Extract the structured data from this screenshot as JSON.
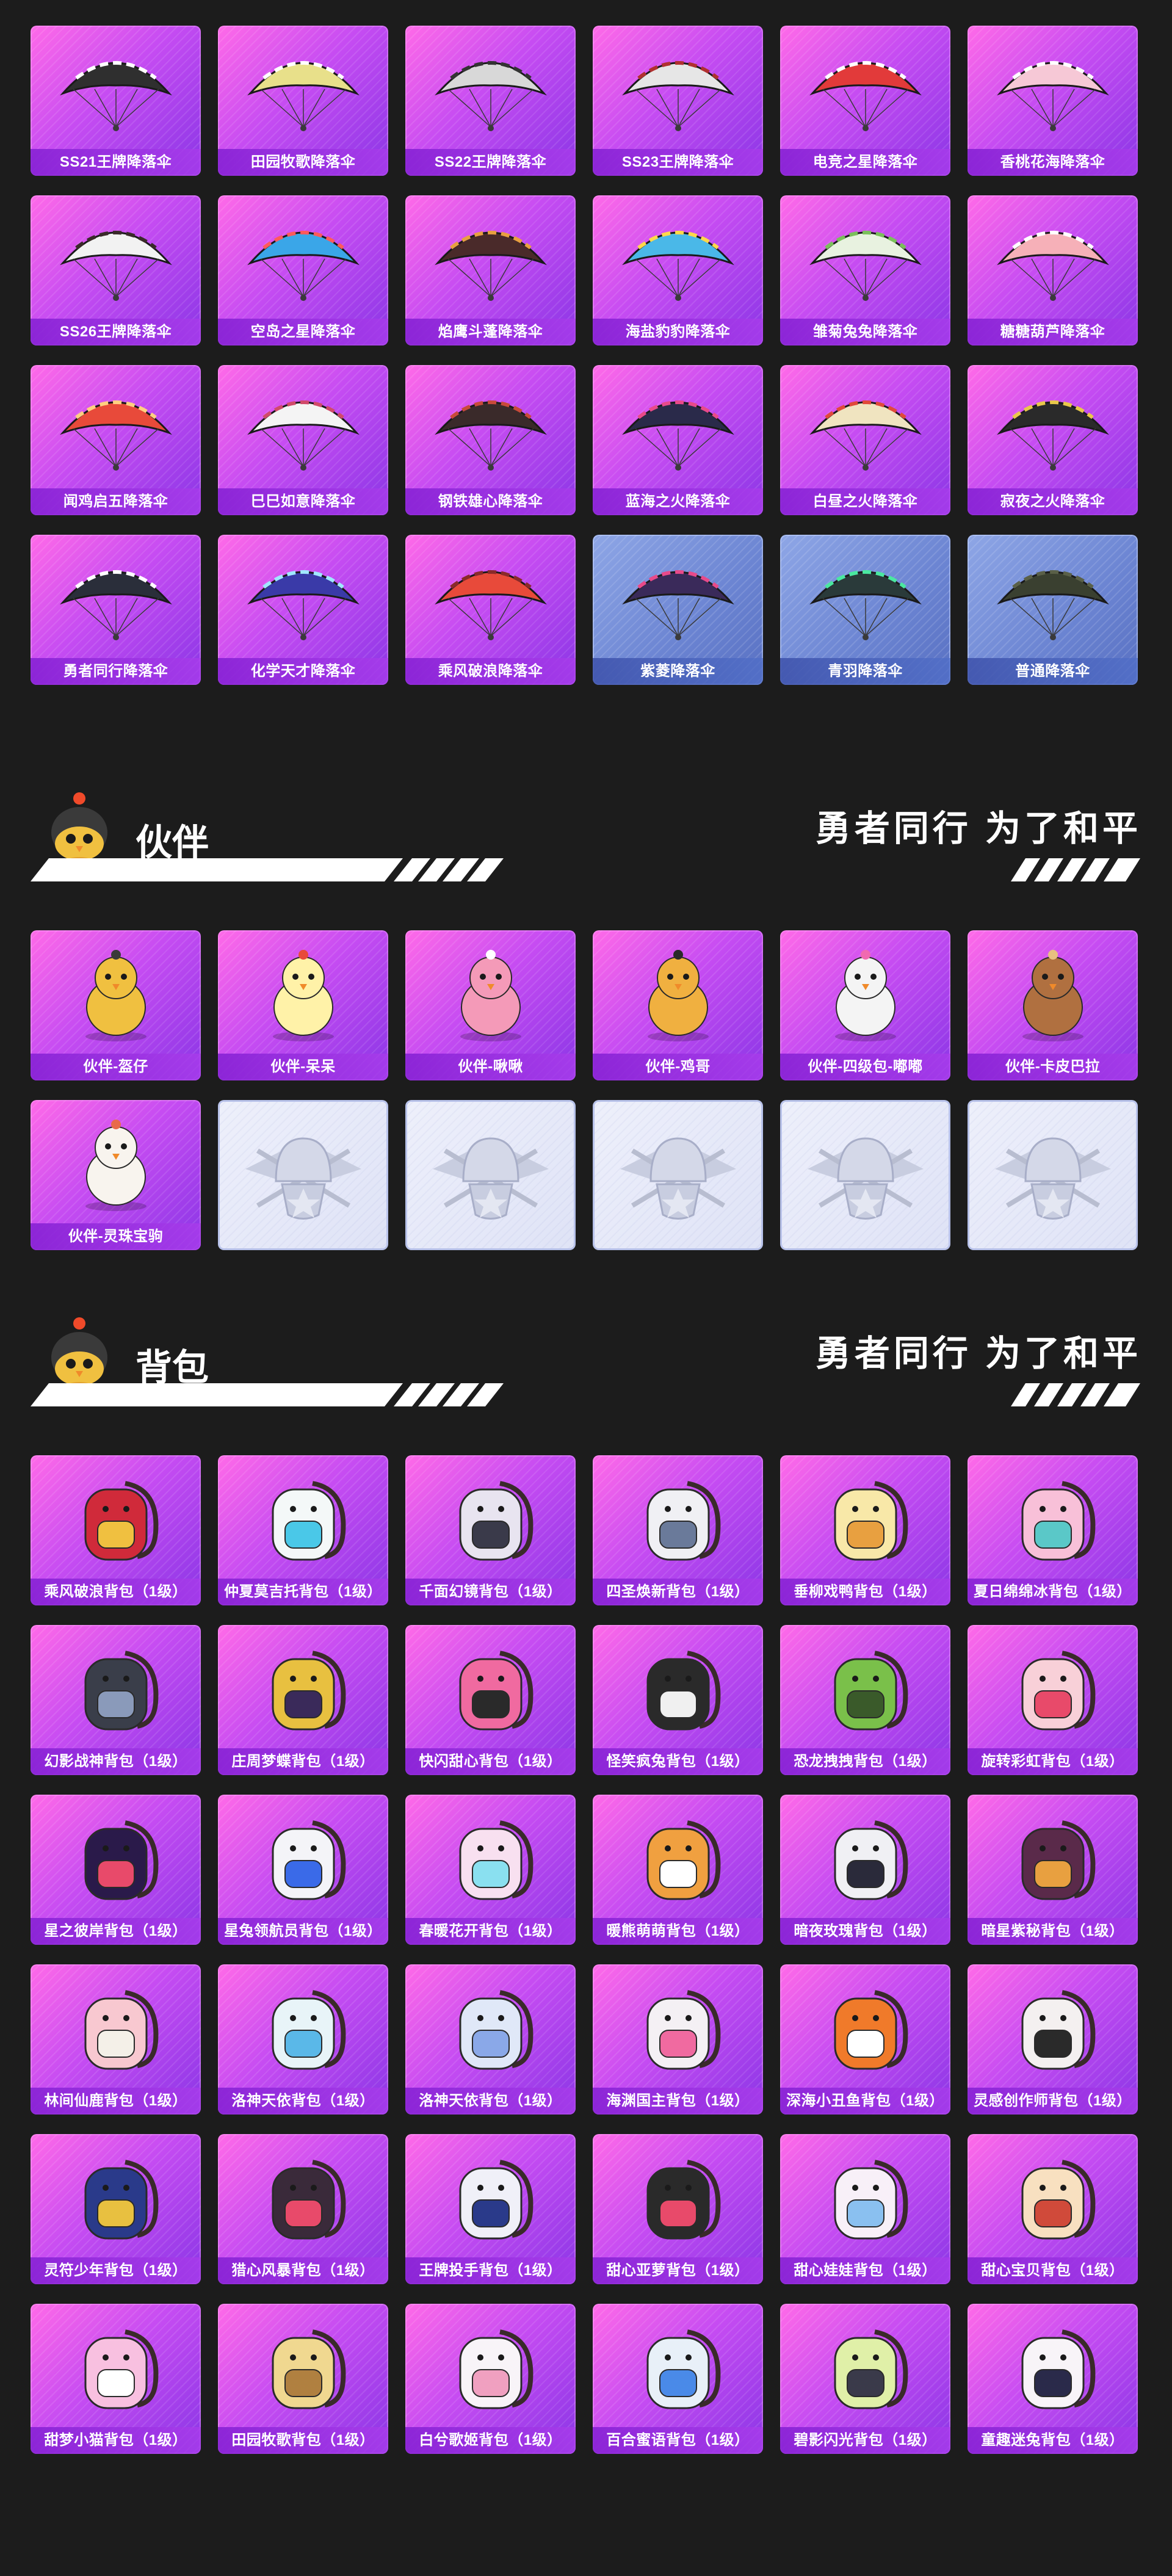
{
  "parachutes": [
    {
      "label": "SS21王牌降落伞",
      "style": "purple",
      "color": "#2f2f2f",
      "accent": "#ffffff"
    },
    {
      "label": "田园牧歌降落伞",
      "style": "purple",
      "color": "#e8e08a",
      "accent": "#ffffff"
    },
    {
      "label": "SS22王牌降落伞",
      "style": "purple",
      "color": "#d8d8d8",
      "accent": "#333333"
    },
    {
      "label": "SS23王牌降落伞",
      "style": "purple",
      "color": "#e6e6e6",
      "accent": "#b03030"
    },
    {
      "label": "电竞之星降落伞",
      "style": "purple",
      "color": "#e23a3a",
      "accent": "#ffffff"
    },
    {
      "label": "香桃花海降落伞",
      "style": "purple",
      "color": "#f6c8d6",
      "accent": "#ffffff"
    },
    {
      "label": "SS26王牌降落伞",
      "style": "purple",
      "color": "#f2f2f2",
      "accent": "#3a2a2a"
    },
    {
      "label": "空岛之星降落伞",
      "style": "purple",
      "color": "#3aa6e8",
      "accent": "#ff5a5a"
    },
    {
      "label": "焰鹰斗蓬降落伞",
      "style": "purple",
      "color": "#4a2a2a",
      "accent": "#e8a040"
    },
    {
      "label": "海盐豹豹降落伞",
      "style": "purple",
      "color": "#4ab8e8",
      "accent": "#ffd84a"
    },
    {
      "label": "雏菊兔兔降落伞",
      "style": "purple",
      "color": "#e8f2e0",
      "accent": "#7ac05a"
    },
    {
      "label": "糖糖葫芦降落伞",
      "style": "purple",
      "color": "#f6b0b8",
      "accent": "#ffffff"
    },
    {
      "label": "闻鸡启五降落伞",
      "style": "purple",
      "color": "#e84a3a",
      "accent": "#ffd080"
    },
    {
      "label": "巳巳如意降落伞",
      "style": "purple",
      "color": "#f4f4f4",
      "accent": "#d04a6a"
    },
    {
      "label": "钢铁雄心降落伞",
      "style": "purple",
      "color": "#3a2a2a",
      "accent": "#c84a3a"
    },
    {
      "label": "蓝海之火降落伞",
      "style": "purple",
      "color": "#2a2a4a",
      "accent": "#e84a8a"
    },
    {
      "label": "白昼之火降落伞",
      "style": "purple",
      "color": "#f0e4c0",
      "accent": "#e04a3a"
    },
    {
      "label": "寂夜之火降落伞",
      "style": "purple",
      "color": "#2a2a2a",
      "accent": "#e8c84a"
    },
    {
      "label": "勇者同行降落伞",
      "style": "purple",
      "color": "#2a2e3a",
      "accent": "#ffffff"
    },
    {
      "label": "化学天才降落伞",
      "style": "purple",
      "color": "#3a3aa8",
      "accent": "#a0e8ff"
    },
    {
      "label": "乘风破浪降落伞",
      "style": "purple",
      "color": "#e84a3a",
      "accent": "#8a2a2a"
    },
    {
      "label": "紫菱降落伞",
      "style": "blue",
      "color": "#3a2a5a",
      "accent": "#e84a8a"
    },
    {
      "label": "青羽降落伞",
      "style": "blue",
      "color": "#2a3a3a",
      "accent": "#4ae8a0"
    },
    {
      "label": "普通降落伞",
      "style": "blue",
      "color": "#3a4030",
      "accent": "#5a6048"
    }
  ],
  "companion_section": {
    "title": "伙伴",
    "slogan": "勇者同行 为了和平"
  },
  "companions": [
    {
      "label": "伙伴-盔仔",
      "style": "purple",
      "color": "#f0c040",
      "accent": "#3a3a3a"
    },
    {
      "label": "伙伴-呆呆",
      "style": "purple",
      "color": "#fff2a8",
      "accent": "#e84a3a"
    },
    {
      "label": "伙伴-啾啾",
      "style": "purple",
      "color": "#f49ab8",
      "accent": "#ffffff"
    },
    {
      "label": "伙伴-鸡哥",
      "style": "purple",
      "color": "#f0b040",
      "accent": "#2a2a2a"
    },
    {
      "label": "伙伴-四级包-嘟嘟",
      "style": "purple",
      "color": "#f4f4f4",
      "accent": "#f06ab0"
    },
    {
      "label": "伙伴-卡皮巴拉",
      "style": "purple",
      "color": "#b07040",
      "accent": "#e8c080"
    },
    {
      "label": "伙伴-灵珠宝驹",
      "style": "purple",
      "color": "#f8f4ee",
      "accent": "#e86a4a"
    },
    {
      "label": "",
      "style": "placeholder"
    },
    {
      "label": "",
      "style": "placeholder"
    },
    {
      "label": "",
      "style": "placeholder"
    },
    {
      "label": "",
      "style": "placeholder"
    },
    {
      "label": "",
      "style": "placeholder"
    }
  ],
  "backpack_section": {
    "title": "背包",
    "slogan": "勇者同行 为了和平"
  },
  "backpacks": [
    {
      "label": "乘风破浪背包（1级）",
      "style": "purple",
      "color": "#d02a3a",
      "accent": "#f0c040"
    },
    {
      "label": "仲夏莫吉托背包（1级）",
      "style": "purple",
      "color": "#f4f8f8",
      "accent": "#4ac8e8"
    },
    {
      "label": "千面幻镜背包（1级）",
      "style": "purple",
      "color": "#e8e4f0",
      "accent": "#3a3a4a"
    },
    {
      "label": "四圣焕新背包（1级）",
      "style": "purple",
      "color": "#f0f0f4",
      "accent": "#6a7a9a"
    },
    {
      "label": "垂柳戏鸭背包（1级）",
      "style": "purple",
      "color": "#f8e8a8",
      "accent": "#e8a040"
    },
    {
      "label": "夏日绵绵冰背包（1级）",
      "style": "purple",
      "color": "#f8c0d8",
      "accent": "#5ac8c8"
    },
    {
      "label": "幻影战神背包（1级）",
      "style": "purple",
      "color": "#3a3e4a",
      "accent": "#8a9aba"
    },
    {
      "label": "庄周梦蝶背包（1级）",
      "style": "purple",
      "color": "#e8c040",
      "accent": "#3a2a5a"
    },
    {
      "label": "快闪甜心背包（1级）",
      "style": "purple",
      "color": "#f06aa0",
      "accent": "#2a2a2a"
    },
    {
      "label": "怪笑疯兔背包（1级）",
      "style": "purple",
      "color": "#2a2a2a",
      "accent": "#f0f0f0"
    },
    {
      "label": "恐龙拽拽背包（1级）",
      "style": "purple",
      "color": "#7ac04a",
      "accent": "#3a5a2a"
    },
    {
      "label": "旋转彩虹背包（1级）",
      "style": "purple",
      "color": "#f8d0d8",
      "accent": "#e84a6a"
    },
    {
      "label": "星之彼岸背包（1级）",
      "style": "purple",
      "color": "#2a1a4a",
      "accent": "#e84a6a"
    },
    {
      "label": "星兔领航员背包（1级）",
      "style": "purple",
      "color": "#f4f4f8",
      "accent": "#3a6ae8"
    },
    {
      "label": "春暖花开背包（1级）",
      "style": "purple",
      "color": "#f8e0f0",
      "accent": "#8ae0f0"
    },
    {
      "label": "暖熊萌萌背包（1级）",
      "style": "purple",
      "color": "#f0a040",
      "accent": "#ffffff"
    },
    {
      "label": "暗夜玫瑰背包（1级）",
      "style": "purple",
      "color": "#f0f0f4",
      "accent": "#2a2a3a"
    },
    {
      "label": "暗星紫秘背包（1级）",
      "style": "purple",
      "color": "#5a2a4a",
      "accent": "#e8a040"
    },
    {
      "label": "林间仙鹿背包（1级）",
      "style": "purple",
      "color": "#f8c8d0",
      "accent": "#f4f0e8"
    },
    {
      "label": "洛神天依背包（1级）",
      "style": "purple",
      "color": "#e8f4f8",
      "accent": "#5ab8e8"
    },
    {
      "label": "洛神天依背包（1级）",
      "style": "purple",
      "color": "#e0e8f8",
      "accent": "#8aa8e8"
    },
    {
      "label": "海渊国主背包（1级）",
      "style": "purple",
      "color": "#f4f0f4",
      "accent": "#f06aa0"
    },
    {
      "label": "深海小丑鱼背包（1级）",
      "style": "purple",
      "color": "#f07a2a",
      "accent": "#ffffff"
    },
    {
      "label": "灵感创作师背包（1级）",
      "style": "purple",
      "color": "#f4f0f0",
      "accent": "#2a2a2a"
    },
    {
      "label": "灵符少年背包（1级）",
      "style": "purple",
      "color": "#2a3a8a",
      "accent": "#e8c040"
    },
    {
      "label": "猎心风暴背包（1级）",
      "style": "purple",
      "color": "#3a2a3a",
      "accent": "#e84a6a"
    },
    {
      "label": "王牌投手背包（1级）",
      "style": "purple",
      "color": "#f0f0f8",
      "accent": "#2a3a8a"
    },
    {
      "label": "甜心亚萝背包（1级）",
      "style": "purple",
      "color": "#2a2a2a",
      "accent": "#e84a6a"
    },
    {
      "label": "甜心娃娃背包（1级）",
      "style": "purple",
      "color": "#f8f0f8",
      "accent": "#8ac0f0"
    },
    {
      "label": "甜心宝贝背包（1级）",
      "style": "purple",
      "color": "#f8e0c0",
      "accent": "#d04a3a"
    },
    {
      "label": "甜梦小猫背包（1级）",
      "style": "purple",
      "color": "#f8c0e0",
      "accent": "#ffffff"
    },
    {
      "label": "田园牧歌背包（1级）",
      "style": "purple",
      "color": "#f0d890",
      "accent": "#b08040"
    },
    {
      "label": "白兮歌姬背包（1级）",
      "style": "purple",
      "color": "#f8f4f8",
      "accent": "#f0a0c0"
    },
    {
      "label": "百合蜜语背包（1级）",
      "style": "purple",
      "color": "#e8f0f8",
      "accent": "#4a8ae8"
    },
    {
      "label": "碧影闪光背包（1级）",
      "style": "purple",
      "color": "#e0f0a8",
      "accent": "#3a3a4a"
    },
    {
      "label": "童趣迷兔背包（1级）",
      "style": "purple",
      "color": "#f8f4f8",
      "accent": "#2a2a4a"
    }
  ]
}
